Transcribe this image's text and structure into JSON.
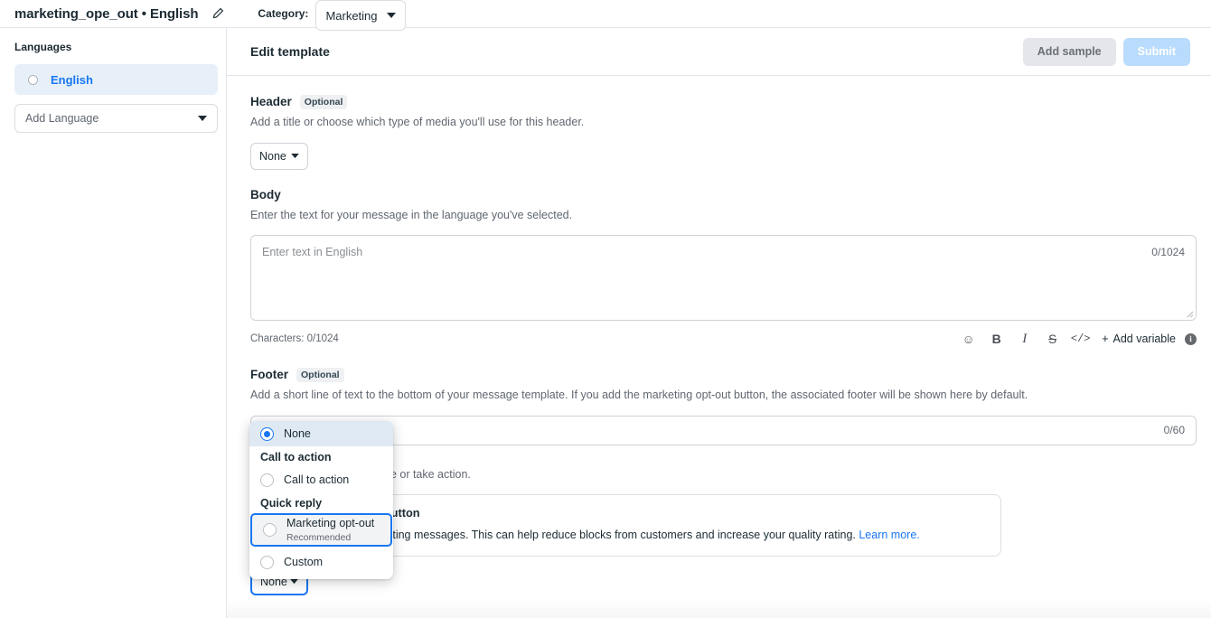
{
  "topbar": {
    "template_name": "marketing_ope_out • English",
    "edit_icon": "pencil-icon",
    "category_label": "Category:",
    "category_value": "Marketing"
  },
  "sidebar": {
    "heading": "Languages",
    "languages": [
      {
        "label": "English",
        "selected": true
      }
    ],
    "add_language_placeholder": "Add Language"
  },
  "main": {
    "title": "Edit template",
    "add_sample_label": "Add sample",
    "submit_label": "Submit"
  },
  "header_section": {
    "title": "Header",
    "badge": "Optional",
    "description": "Add a title or choose which type of media you'll use for this header.",
    "select_value": "None"
  },
  "body_section": {
    "title": "Body",
    "description": "Enter the text for your message in the language you've selected.",
    "textarea_placeholder": "Enter text in English",
    "textarea_counter": "0/1024",
    "characters_label": "Characters: 0/1024",
    "toolbar": {
      "emoji": "☺",
      "bold": "B",
      "italic": "I",
      "strikethrough": "S",
      "code": "</>",
      "add_variable": "Add variable",
      "plus": "+",
      "info": "i"
    }
  },
  "footer_section": {
    "title": "Footer",
    "badge": "Optional",
    "description": "Add a short line of text to the bottom of your message template. If you add the marketing opt-out button, the associated footer will be shown here by default.",
    "input_counter": "0/60"
  },
  "buttons_section": {
    "description_visible_tail": "ers respond to your message or take action.",
    "callout_title_tail": "he marketing opt-out button",
    "callout_body_tail": "est to opt out of all marketing messages. This can help reduce blocks from customers and increase your quality rating.",
    "learn_more": "Learn more.",
    "select_value": "None"
  },
  "dropdown_menu": {
    "options": [
      {
        "label": "None",
        "selected": true,
        "highlighted": false,
        "sub": ""
      },
      {
        "label": "Call to action",
        "selected": false,
        "highlighted": false,
        "sub": ""
      },
      {
        "label": "Marketing opt-out",
        "selected": false,
        "highlighted": true,
        "sub": "Recommended"
      },
      {
        "label": "Custom",
        "selected": false,
        "highlighted": false,
        "sub": ""
      }
    ],
    "group_call_to_action": "Call to action",
    "group_quick_reply": "Quick reply"
  },
  "colors": {
    "accent": "#1877f2",
    "selected_row_bg": "#e7f0f9",
    "text_primary": "#1c2b33",
    "text_secondary": "#606770"
  }
}
